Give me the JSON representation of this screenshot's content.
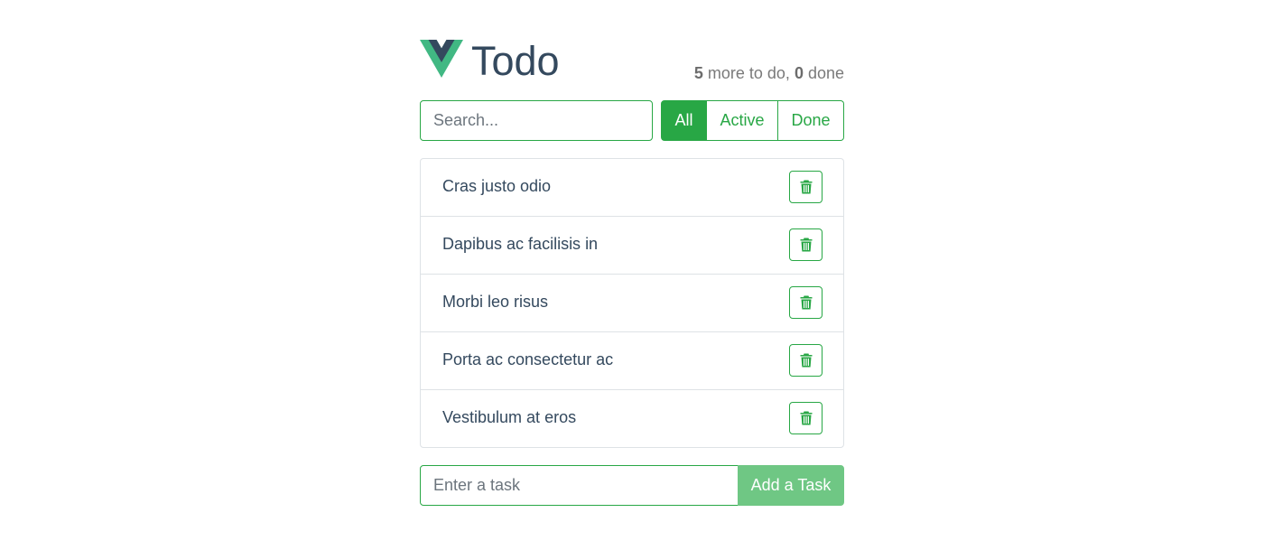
{
  "header": {
    "logo_icon": "vue-logo-icon",
    "title": "Todo",
    "remaining_count": "5",
    "remaining_text": " more to do, ",
    "done_count": "0",
    "done_text": " done"
  },
  "search": {
    "placeholder": "Search...",
    "value": ""
  },
  "filters": [
    {
      "label": "All",
      "active": true
    },
    {
      "label": "Active",
      "active": false
    },
    {
      "label": "Done",
      "active": false
    }
  ],
  "tasks": [
    {
      "text": "Cras justo odio",
      "delete_icon": "trash-icon"
    },
    {
      "text": "Dapibus ac facilisis in",
      "delete_icon": "trash-icon"
    },
    {
      "text": "Morbi leo risus",
      "delete_icon": "trash-icon"
    },
    {
      "text": "Porta ac consectetur ac",
      "delete_icon": "trash-icon"
    },
    {
      "text": "Vestibulum at eros",
      "delete_icon": "trash-icon"
    }
  ],
  "add_task": {
    "placeholder": "Enter a task",
    "value": "",
    "button_label": "Add a Task"
  },
  "colors": {
    "accent": "#28a745",
    "accent_light": "#6fc784",
    "text": "#34495e",
    "vue_green": "#41b883",
    "vue_navy": "#34495e"
  }
}
